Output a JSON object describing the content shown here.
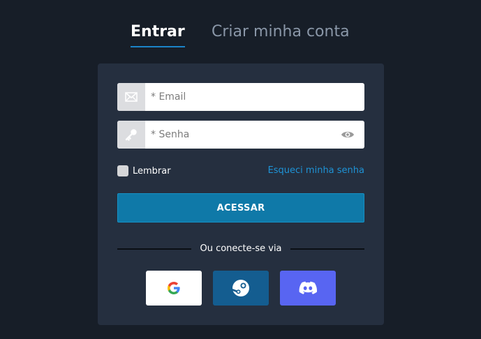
{
  "tabs": {
    "login": "Entrar",
    "register": "Criar minha conta"
  },
  "form": {
    "email_placeholder": "* Email",
    "password_placeholder": "* Senha",
    "remember_label": "Lembrar",
    "forgot_label": "Esqueci minha senha",
    "submit_label": "ACESSAR"
  },
  "social": {
    "divider_text": "Ou conecte-se via",
    "providers": [
      {
        "name": "google-icon"
      },
      {
        "name": "steam-icon"
      },
      {
        "name": "discord-icon"
      }
    ]
  },
  "colors": {
    "background": "#171e28",
    "card": "#252f3f",
    "accent": "#1b84c9",
    "submit": "#0f79a8",
    "steam": "#145d90",
    "discord": "#5865f2"
  }
}
